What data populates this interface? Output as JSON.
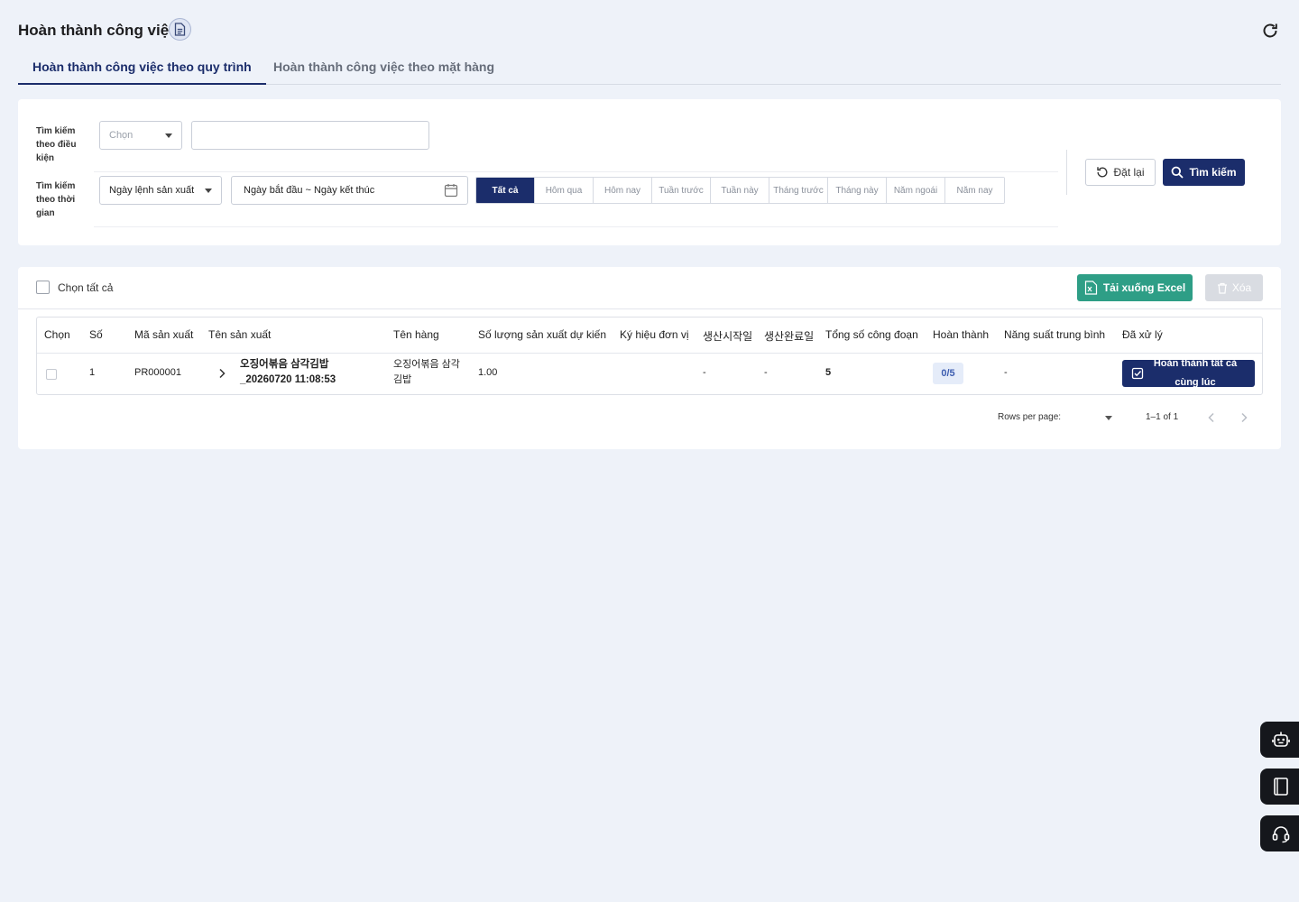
{
  "header": {
    "title": "Hoàn thành công việc"
  },
  "tabs": [
    {
      "label": "Hoàn thành công việc theo quy trình"
    },
    {
      "label": "Hoàn thành công việc theo mặt hàng"
    }
  ],
  "search": {
    "condition_label": "Tìm kiếm theo điều kiện",
    "condition_select_placeholder": "Chọn",
    "condition_input_value": "",
    "time_label": "Tìm kiếm theo thời gian",
    "date_field_select": "Ngày lệnh sản xuất",
    "date_range": "Ngày bắt đầu ~ Ngày kết thúc",
    "quick_ranges": [
      "Tất cả",
      "Hôm qua",
      "Hôm nay",
      "Tuần trước",
      "Tuần này",
      "Tháng trước",
      "Tháng này",
      "Năm ngoái",
      "Năm nay"
    ],
    "active_range": "Tất cả",
    "reset_label": "Đặt lại",
    "search_label": "Tìm kiếm"
  },
  "results": {
    "select_all_label": "Chọn tất cả",
    "excel_label": "Tải xuống Excel",
    "delete_label": "Xóa",
    "columns": [
      "Chọn",
      "Số",
      "Mã sản xuất",
      "Tên sản xuất",
      "Tên hàng",
      "Số lượng sản xuất dự kiến",
      "Ký hiệu đơn vị",
      "생산시작일",
      "생산완료일",
      "Tổng số công đoạn",
      "Hoàn thành",
      "Năng suất trung bình",
      "Đã xử lý"
    ],
    "rows": [
      {
        "no": "1",
        "code": "PR000001",
        "prod_name_line1": "오징어볶음 삼각김밥",
        "prod_name_line2": "_20260720 11:08:53",
        "item_line1": "오징어볶음 삼각",
        "item_line2": "김밥",
        "qty": "1.00",
        "unit": "",
        "start": "-",
        "end": "-",
        "total_steps": "5",
        "completed": "0/5",
        "avg_productivity": "-",
        "action_line1": "Hoàn thành tất cả",
        "action_line2": "cùng lúc"
      }
    ]
  },
  "pagination": {
    "rows_per_page_label": "Rows per page:",
    "range": "1–1 of 1"
  },
  "colors": {
    "primary": "#1b2d6b",
    "excel": "#2e9e86",
    "background": "#eef2f9"
  }
}
